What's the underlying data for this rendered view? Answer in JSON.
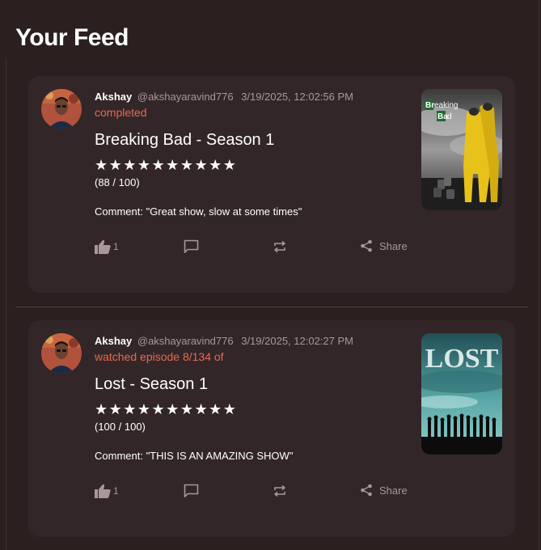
{
  "feed": {
    "title": "Your Feed",
    "posts": [
      {
        "user_name": "Akshay",
        "user_handle": "@akshayaravind776",
        "timestamp": "3/19/2025, 12:02:56 PM",
        "status": "completed",
        "show_title": "Breaking Bad - Season 1",
        "stars": "★★★★★★★★★★",
        "score": "(88 / 100)",
        "comment": "Comment: \"Great show, slow at some times\"",
        "like_count": "1",
        "share_label": "Share",
        "poster_title_1": "Br",
        "poster_title_2": "eaking",
        "poster_title_3": "Ba",
        "poster_title_4": "d"
      },
      {
        "user_name": "Akshay",
        "user_handle": "@akshayaravind776",
        "timestamp": "3/19/2025, 12:02:27 PM",
        "status": "watched episode 8/134 of",
        "show_title": "Lost - Season 1",
        "stars": "★★★★★★★★★★",
        "score": "(100 / 100)",
        "comment": "Comment: \"THIS IS AN AMAZING SHOW\"",
        "like_count": "1",
        "share_label": "Share",
        "poster_title": "LOST"
      }
    ]
  },
  "colors": {
    "background": "#2b1f20",
    "card": "#332628",
    "accent": "#e56a4f",
    "muted": "#a8989a"
  },
  "icons": [
    "thumbs-up-icon",
    "comment-icon",
    "repost-icon",
    "share-icon"
  ]
}
